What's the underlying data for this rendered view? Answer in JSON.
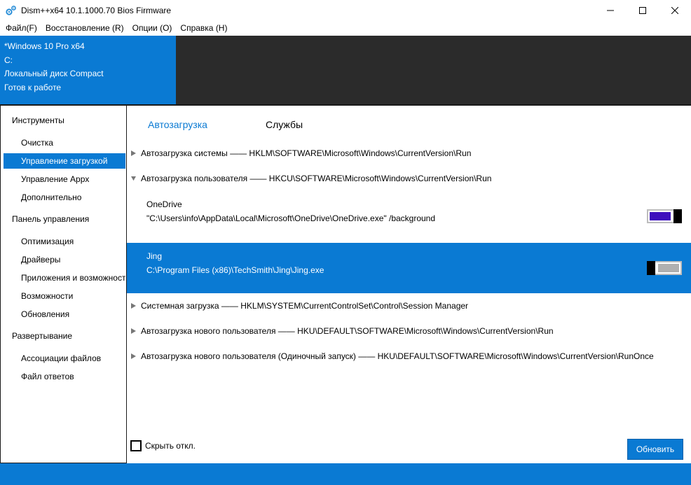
{
  "window": {
    "title": "Dism++x64 10.1.1000.70 Bios Firmware"
  },
  "menu": [
    {
      "label": "Файл(F)"
    },
    {
      "label": "Восстановление (R)"
    },
    {
      "label": "Опции (O)"
    },
    {
      "label": "Справка (H)"
    }
  ],
  "info": {
    "os": "*Windows 10 Pro x64",
    "drive": "C:",
    "disk": "Локальный диск Compact",
    "status": "Готов к работе"
  },
  "sidebar": {
    "sections": [
      {
        "title": "Инструменты",
        "items": [
          "Очистка",
          "Управление загрузкой",
          "Управление Appx",
          "Дополнительно"
        ]
      },
      {
        "title": "Панель управления",
        "items": [
          "Оптимизация",
          "Драйверы",
          "Приложения и возможности",
          "Возможности",
          "Обновления"
        ]
      },
      {
        "title": "Развертывание",
        "items": [
          "Ассоциации файлов",
          "Файл ответов"
        ]
      }
    ],
    "active_item": "Управление загрузкой"
  },
  "tabs": [
    {
      "label": "Автозагрузка",
      "active": true
    },
    {
      "label": "Службы",
      "active": false
    }
  ],
  "groups": [
    {
      "label": "Автозагрузка системы —— HKLM\\SOFTWARE\\Microsoft\\Windows\\CurrentVersion\\Run",
      "expanded": false
    },
    {
      "label": "Автозагрузка пользователя —— HKCU\\SOFTWARE\\Microsoft\\Windows\\CurrentVersion\\Run",
      "expanded": true
    },
    {
      "label": "Системная загрузка —— HKLM\\SYSTEM\\CurrentControlSet\\Control\\Session Manager",
      "expanded": false
    },
    {
      "label": "Автозагрузка нового пользователя —— HKU\\DEFAULT\\SOFTWARE\\Microsoft\\Windows\\CurrentVersion\\Run",
      "expanded": false
    },
    {
      "label": "Автозагрузка нового пользователя (Одиночный запуск) —— HKU\\DEFAULT\\SOFTWARE\\Microsoft\\Windows\\CurrentVersion\\RunOnce",
      "expanded": false
    }
  ],
  "entries": [
    {
      "name": "OneDrive",
      "path": "\"C:\\Users\\info\\AppData\\Local\\Microsoft\\OneDrive\\OneDrive.exe\" /background",
      "enabled": true,
      "selected": false
    },
    {
      "name": "Jing",
      "path": "C:\\Program Files (x86)\\TechSmith\\Jing\\Jing.exe",
      "enabled": false,
      "selected": true
    }
  ],
  "footer": {
    "hide_disabled_label": "Скрыть откл.",
    "refresh_label": "Обновить"
  },
  "colors": {
    "accent": "#0a7ad3",
    "toggle_on": "#3e0fbd",
    "toggle_off": "#b0b0b0",
    "dark_panel": "#2b2b2b"
  }
}
